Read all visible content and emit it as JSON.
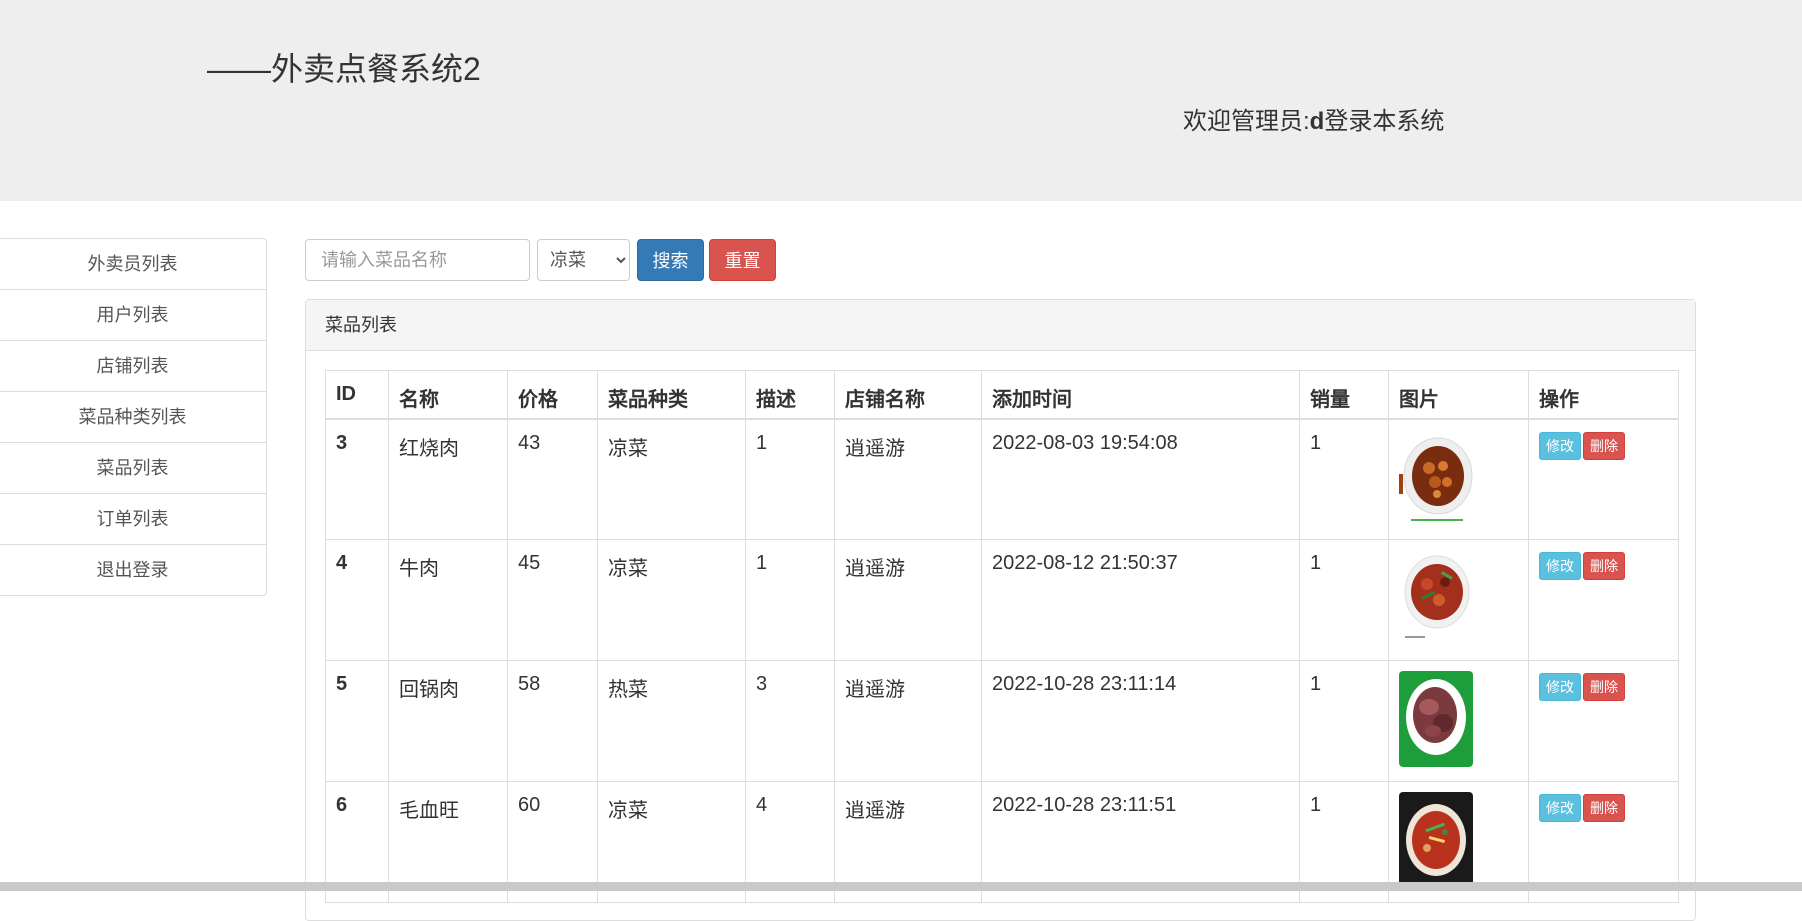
{
  "header": {
    "title": "——外卖点餐系统2",
    "welcome_prefix": "欢迎管理员:",
    "admin_name": "d",
    "welcome_suffix": "登录本系统"
  },
  "sidebar": {
    "items": [
      {
        "label": "外卖员列表"
      },
      {
        "label": "用户列表"
      },
      {
        "label": "店铺列表"
      },
      {
        "label": "菜品种类列表"
      },
      {
        "label": "菜品列表"
      },
      {
        "label": "订单列表"
      },
      {
        "label": "退出登录"
      }
    ]
  },
  "search": {
    "placeholder": "请输入菜品名称",
    "value": "",
    "category_selected": "凉菜",
    "search_label": "搜索",
    "reset_label": "重置"
  },
  "panel": {
    "title": "菜品列表"
  },
  "table": {
    "columns": [
      "ID",
      "名称",
      "价格",
      "菜品种类",
      "描述",
      "店铺名称",
      "添加时间",
      "销量",
      "图片",
      "操作"
    ],
    "edit_label": "修改",
    "delete_label": "删除",
    "rows": [
      {
        "id": "3",
        "name": "红烧肉",
        "price": "43",
        "category": "凉菜",
        "desc": "1",
        "shop": "逍遥游",
        "time": "2022-08-03 19:54:08",
        "sales": "1",
        "image": "braised-pork-image"
      },
      {
        "id": "4",
        "name": "牛肉",
        "price": "45",
        "category": "凉菜",
        "desc": "1",
        "shop": "逍遥游",
        "time": "2022-08-12 21:50:37",
        "sales": "1",
        "image": "beef-dish-image"
      },
      {
        "id": "5",
        "name": "回锅肉",
        "price": "58",
        "category": "热菜",
        "desc": "3",
        "shop": "逍遥游",
        "time": "2022-10-28 23:11:14",
        "sales": "1",
        "image": "twice-cooked-pork-image"
      },
      {
        "id": "6",
        "name": "毛血旺",
        "price": "60",
        "category": "凉菜",
        "desc": "4",
        "shop": "逍遥游",
        "time": "2022-10-28 23:11:51",
        "sales": "1",
        "image": "maoxuewang-image"
      }
    ]
  },
  "colors": {
    "primary": "#337ab7",
    "danger": "#d9534f",
    "info": "#5bc0de",
    "header_bg": "#eeeeee"
  }
}
